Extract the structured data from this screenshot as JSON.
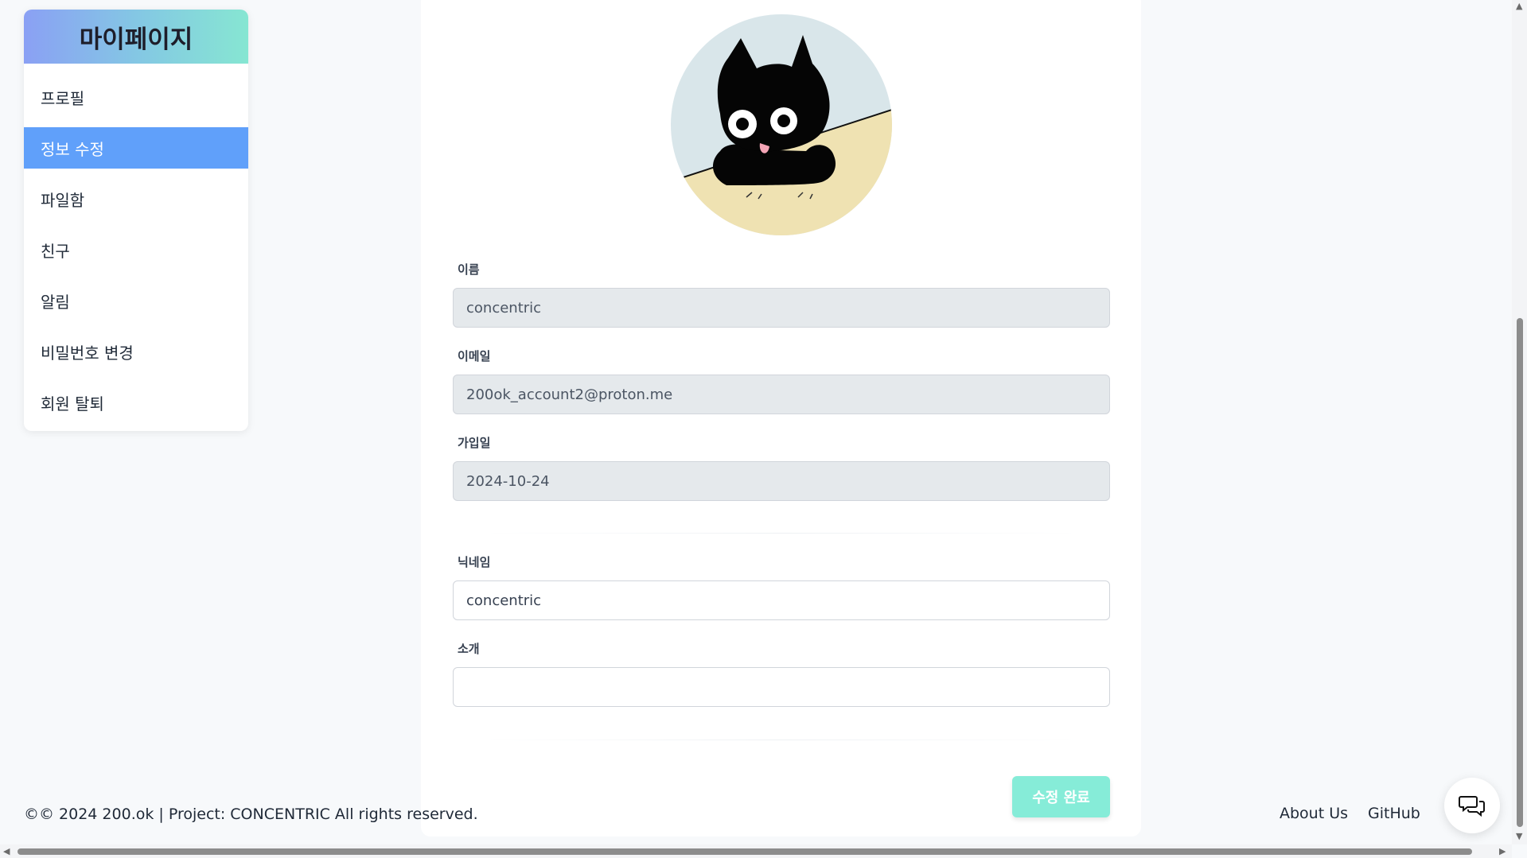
{
  "sidebar": {
    "title": "마이페이지",
    "items": [
      {
        "label": "프로필"
      },
      {
        "label": "정보 수정"
      },
      {
        "label": "파일함"
      },
      {
        "label": "친구"
      },
      {
        "label": "알림"
      },
      {
        "label": "비밀번호 변경"
      },
      {
        "label": "회원 탈퇴"
      }
    ],
    "active_item": "정보 수정",
    "header_gradient": [
      "#8aa0f4",
      "#86e6d2"
    ],
    "active_color": "#60a0fa"
  },
  "form": {
    "name": {
      "label": "이름",
      "value": "concentric"
    },
    "email": {
      "label": "이메일",
      "value": "200ok_account2@proton.me"
    },
    "joined": {
      "label": "가입일",
      "value": "2024-10-24"
    },
    "nickname": {
      "label": "닉네임",
      "value": "concentric"
    },
    "intro": {
      "label": "소개",
      "value": ""
    },
    "submit_label": "수정 완료",
    "submit_color": "#86ecd8"
  },
  "footer": {
    "copyright": "©© 2024 200.ok | Project: CONCENTRIC All rights reserved.",
    "links": [
      {
        "label": "About Us"
      },
      {
        "label": "GitHub"
      }
    ]
  },
  "icons": {
    "chat": "chat-bubbles-icon",
    "avatar": "profile-avatar-cat"
  }
}
